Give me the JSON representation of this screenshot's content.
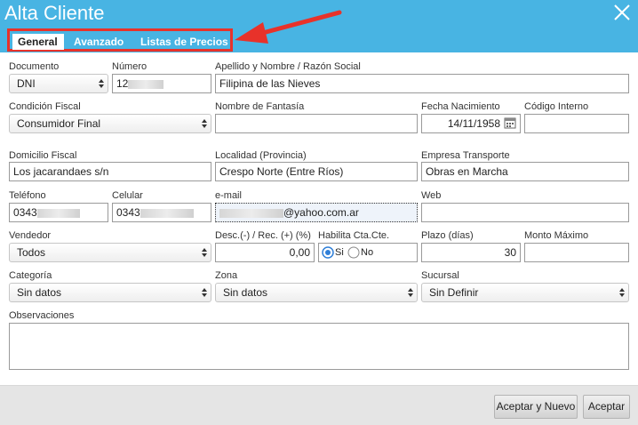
{
  "dialog": {
    "title": "Alta Cliente",
    "accent_color": "#48b4e3",
    "highlight_color": "#e8322a"
  },
  "tabs": [
    {
      "label": "General",
      "active": true
    },
    {
      "label": "Avanzado"
    },
    {
      "label": "Listas de Precios"
    }
  ],
  "form": {
    "documento": {
      "label": "Documento",
      "value": "DNI"
    },
    "numero": {
      "label": "Número",
      "value": "12"
    },
    "apellido": {
      "label": "Apellido y Nombre / Razón Social",
      "value": "Filipina de las Nieves"
    },
    "condicion": {
      "label": "Condición Fiscal",
      "value": "Consumidor Final"
    },
    "fantasia": {
      "label": "Nombre de Fantasía",
      "value": ""
    },
    "nacimiento": {
      "label": "Fecha Nacimiento",
      "value": "14/11/1958"
    },
    "codigo": {
      "label": "Código Interno",
      "value": ""
    },
    "domicilio": {
      "label": "Domicilio Fiscal",
      "value": "Los jacarandaes s/n"
    },
    "localidad": {
      "label": "Localidad (Provincia)",
      "value": "Crespo Norte (Entre Ríos)"
    },
    "transporte": {
      "label": "Empresa Transporte",
      "value": "Obras en Marcha"
    },
    "telefono": {
      "label": "Teléfono",
      "value": "0343"
    },
    "celular": {
      "label": "Celular",
      "value": "0343"
    },
    "email": {
      "label": "e-mail",
      "value": "@yahoo.com.ar"
    },
    "web": {
      "label": "Web",
      "value": ""
    },
    "vendedor": {
      "label": "Vendedor",
      "value": "Todos"
    },
    "desc": {
      "label": "Desc.(-) / Rec. (+) (%)",
      "value": "0,00"
    },
    "habilita": {
      "label": "Habilita Cta.Cte.",
      "opt_si": "Si",
      "opt_no": "No",
      "selected": "Si"
    },
    "plazo": {
      "label": "Plazo (días)",
      "value": "30"
    },
    "monto": {
      "label": "Monto Máximo",
      "value": ""
    },
    "categoria": {
      "label": "Categoría",
      "value": "Sin datos"
    },
    "zona": {
      "label": "Zona",
      "value": "Sin datos"
    },
    "sucursal": {
      "label": "Sucursal",
      "value": "Sin Definir"
    },
    "observaciones": {
      "label": "Observaciones",
      "value": ""
    }
  },
  "footer": {
    "accept_new_label": "Aceptar y Nuevo",
    "accept_label": "Aceptar"
  }
}
